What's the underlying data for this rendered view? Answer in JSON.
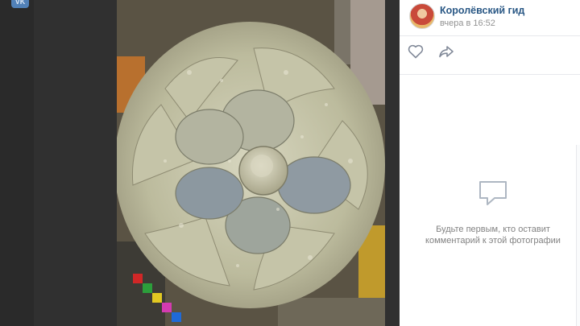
{
  "app": {
    "logo_text": "VK"
  },
  "photo": {
    "subject": "stone-rosette-photo"
  },
  "sidebar": {
    "author_name": "Королёвский гид",
    "post_time": "вчера в 16:52",
    "actions": {
      "like_icon": "heart-icon",
      "share_icon": "share-arrow-icon"
    },
    "empty_comments": {
      "icon": "speech-bubble-icon",
      "line1": "Будьте первым, кто оставит",
      "line2": "комментарий к этой фотографии"
    }
  },
  "colors": {
    "link": "#2a5885",
    "muted": "#939393",
    "icon": "#828a99",
    "empty_icon": "#aeb7c2"
  }
}
